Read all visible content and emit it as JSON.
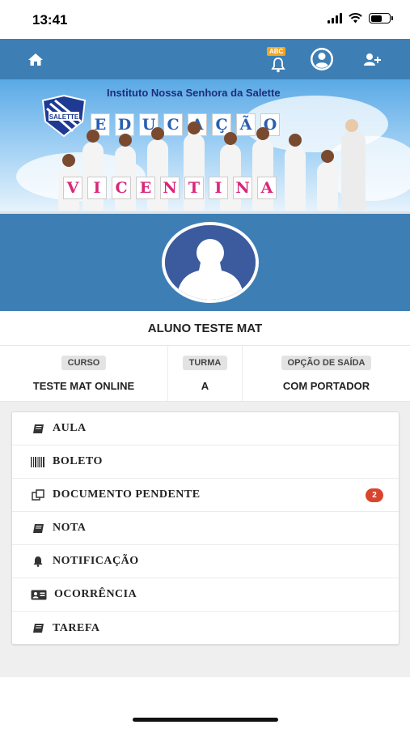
{
  "status_bar": {
    "time": "13:41",
    "battery_level": 0.6
  },
  "nav": {
    "bell_badge": "ABC",
    "icons": [
      "home-icon",
      "bell-icon",
      "user-circle-icon",
      "user-plus-icon"
    ],
    "background_color": "#3d7fb5"
  },
  "banner": {
    "school_name": "Instituto Nossa Senhora da Salette",
    "crest_text": "SALETTE",
    "word_top": [
      "E",
      "D",
      "U",
      "C",
      "A",
      "Ç",
      "Ã",
      "O"
    ],
    "word_bottom": [
      "V",
      "I",
      "C",
      "E",
      "N",
      "T",
      "I",
      "N",
      "A"
    ]
  },
  "student": {
    "name": "ALUNO TESTE MAT"
  },
  "info": {
    "curso_label": "CURSO",
    "curso_value": "TESTE MAT ONLINE",
    "turma_label": "TURMA",
    "turma_value": "A",
    "saida_label": "OPÇÃO DE SAÍDA",
    "saida_value": "COM PORTADOR"
  },
  "menu": {
    "items": [
      {
        "label": "AULA",
        "icon": "book-icon"
      },
      {
        "label": "BOLETO",
        "icon": "barcode-icon"
      },
      {
        "label": "DOCUMENTO PENDENTE",
        "icon": "documents-icon",
        "badge": "2"
      },
      {
        "label": "NOTA",
        "icon": "book-icon"
      },
      {
        "label": "NOTIFICAÇÃO",
        "icon": "bell-icon"
      },
      {
        "label": "OCORRÊNCIA",
        "icon": "id-card-icon"
      },
      {
        "label": "TAREFA",
        "icon": "book-icon"
      }
    ]
  },
  "colors": {
    "accent": "#3d7fb5",
    "badge": "#d9442e",
    "abc_badge": "#f4a521"
  }
}
